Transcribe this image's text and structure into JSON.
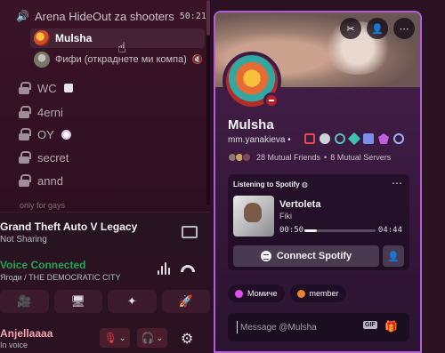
{
  "voice_channel": {
    "name": "Arena HideOut za shooters",
    "timer": "50:21"
  },
  "voice_users": [
    {
      "name": "Mulsha",
      "active": true
    },
    {
      "name": "Фифи (откраднете ми компа)"
    }
  ],
  "channels": [
    {
      "name": "WC",
      "emoji": "square"
    },
    {
      "name": "4erni"
    },
    {
      "name": "OY",
      "emoji": "dot"
    },
    {
      "name": "secret"
    },
    {
      "name": "annd"
    }
  ],
  "faded_channel": "only for gays",
  "activity": {
    "title": "Grand Theft Auto V Legacy",
    "subtitle": "Not Sharing"
  },
  "voice_status": {
    "label": "Voice Connected",
    "server": "Ягоди / THE DEMOCRATIC CITY"
  },
  "voice_buttons": [
    "🎥",
    "🖥",
    "✦",
    "🚀"
  ],
  "user_panel": {
    "name": "Anjellaaaa",
    "status": "In voice"
  },
  "profile": {
    "display_name": "Mulsha",
    "handle": "mm.yanakieva",
    "mutual_friends": "28 Mutual Friends",
    "mutual_servers": "8 Mutual Servers"
  },
  "spotify": {
    "header": "Listening to Spotify",
    "track": "Vertoleta",
    "artist": "Fiki",
    "current": "00:50",
    "end": "04:44",
    "progress": 0.18,
    "connect_label": "Connect Spotify"
  },
  "roles": [
    {
      "name": "Момиче",
      "color": "#e54cf0"
    },
    {
      "name": "member",
      "color": "#e8852a"
    }
  ],
  "message": {
    "placeholder": "Message @Mulsha",
    "gif_label": "GIF"
  },
  "colors": {
    "voice_green": "#23a559",
    "profile_border": "#b65bd8",
    "mute_red": "#f23f43"
  }
}
